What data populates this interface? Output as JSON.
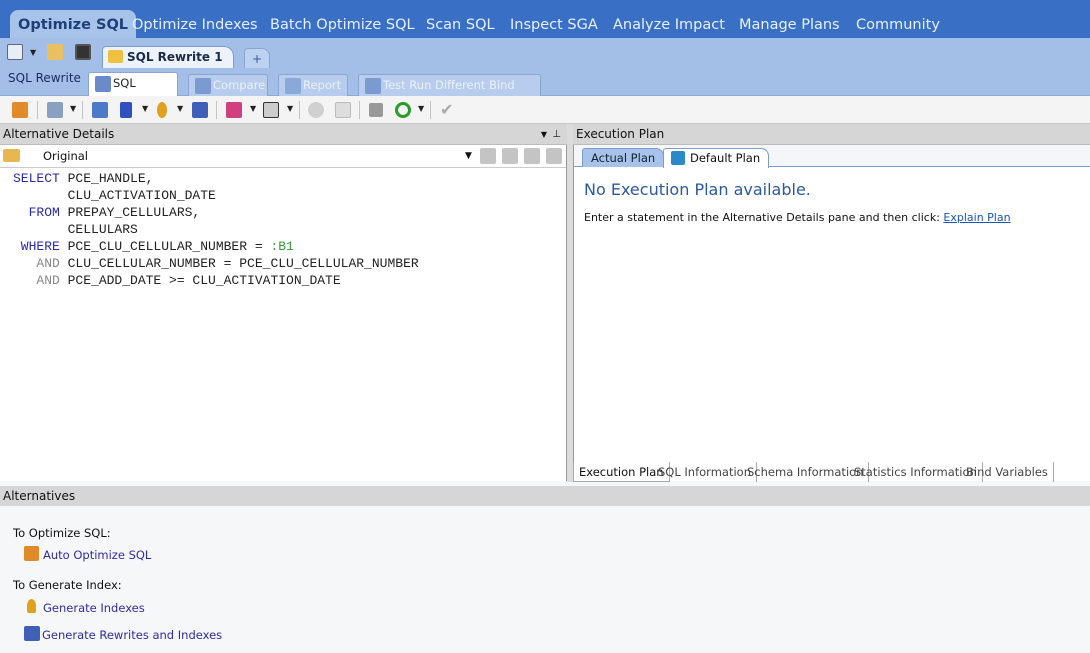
{
  "nav": {
    "tabs": [
      "Optimize SQL",
      "Optimize Indexes",
      "Batch Optimize SQL",
      "Scan SQL",
      "Inspect SGA",
      "Analyze Impact",
      "Manage Plans",
      "Community"
    ],
    "active": "Optimize SQL"
  },
  "document_tab": {
    "label": "SQL Rewrite 1",
    "close": "✕",
    "add": "+"
  },
  "section": {
    "label": "SQL Rewrite",
    "subtabs": [
      "SQL Details",
      "Compare",
      "Report",
      "Test Run Different Bind Values"
    ]
  },
  "left_pane": {
    "title": "Alternative Details",
    "selector": "Original",
    "sql": [
      [
        {
          "t": "SELECT ",
          "c": "kw"
        },
        {
          "t": "PCE_HANDLE,"
        }
      ],
      [
        {
          "t": "       CLU_ACTIVATION_DATE"
        }
      ],
      [
        {
          "t": "  FROM ",
          "c": "kw"
        },
        {
          "t": "PREPAY_CELLULARS,"
        }
      ],
      [
        {
          "t": "       CELLULARS"
        }
      ],
      [
        {
          "t": " WHERE ",
          "c": "kw"
        },
        {
          "t": "PCE_CLU_CELLULAR_NUMBER = "
        },
        {
          "t": ":B1",
          "c": "bind"
        }
      ],
      [
        {
          "t": "   AND ",
          "c": "kw2"
        },
        {
          "t": "CLU_CELLULAR_NUMBER = PCE_CLU_CELLULAR_NUMBER"
        }
      ],
      [
        {
          "t": "   AND ",
          "c": "kw2"
        },
        {
          "t": "PCE_ADD_DATE >= CLU_ACTIVATION_DATE"
        }
      ]
    ]
  },
  "right_pane": {
    "title": "Execution Plan",
    "plan_tabs": [
      "Actual Plan",
      "Default Plan"
    ],
    "message": "No Execution Plan available.",
    "hint": "Enter a statement in the Alternative Details pane and then click:",
    "hint_link": "Explain Plan",
    "bottom_tabs": [
      "Execution Plan",
      "SQL Information",
      "Schema Information",
      "Statistics Information",
      "Bind Variables"
    ]
  },
  "alternatives": {
    "title": "Alternatives",
    "optimize_label": "To Optimize SQL:",
    "auto_optimize": "Auto Optimize SQL",
    "index_label": "To Generate Index:",
    "gen_indexes": "Generate Indexes",
    "gen_rewrites": "Generate Rewrites and Indexes"
  }
}
